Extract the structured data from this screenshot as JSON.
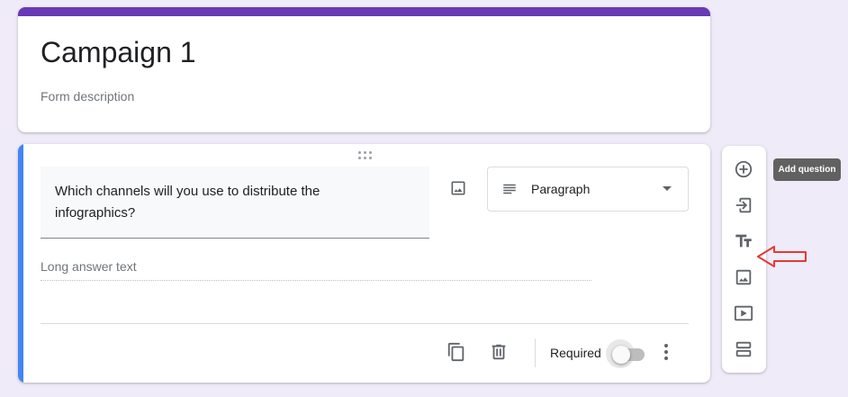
{
  "form": {
    "title": "Campaign 1",
    "description_placeholder": "Form description",
    "accent_color": "#673ab7"
  },
  "question": {
    "text": "Which channels will you use to distribute the infographics?",
    "type_label": "Paragraph",
    "answer_placeholder": "Long answer text",
    "required_label": "Required",
    "required": false,
    "active_color": "#4285f4"
  },
  "toolbar": {
    "buttons": [
      "add-question",
      "import-questions",
      "add-title-and-description",
      "add-image",
      "add-video",
      "add-section"
    ],
    "tooltip": "Add question"
  },
  "annotation": {
    "color": "#e53935"
  }
}
